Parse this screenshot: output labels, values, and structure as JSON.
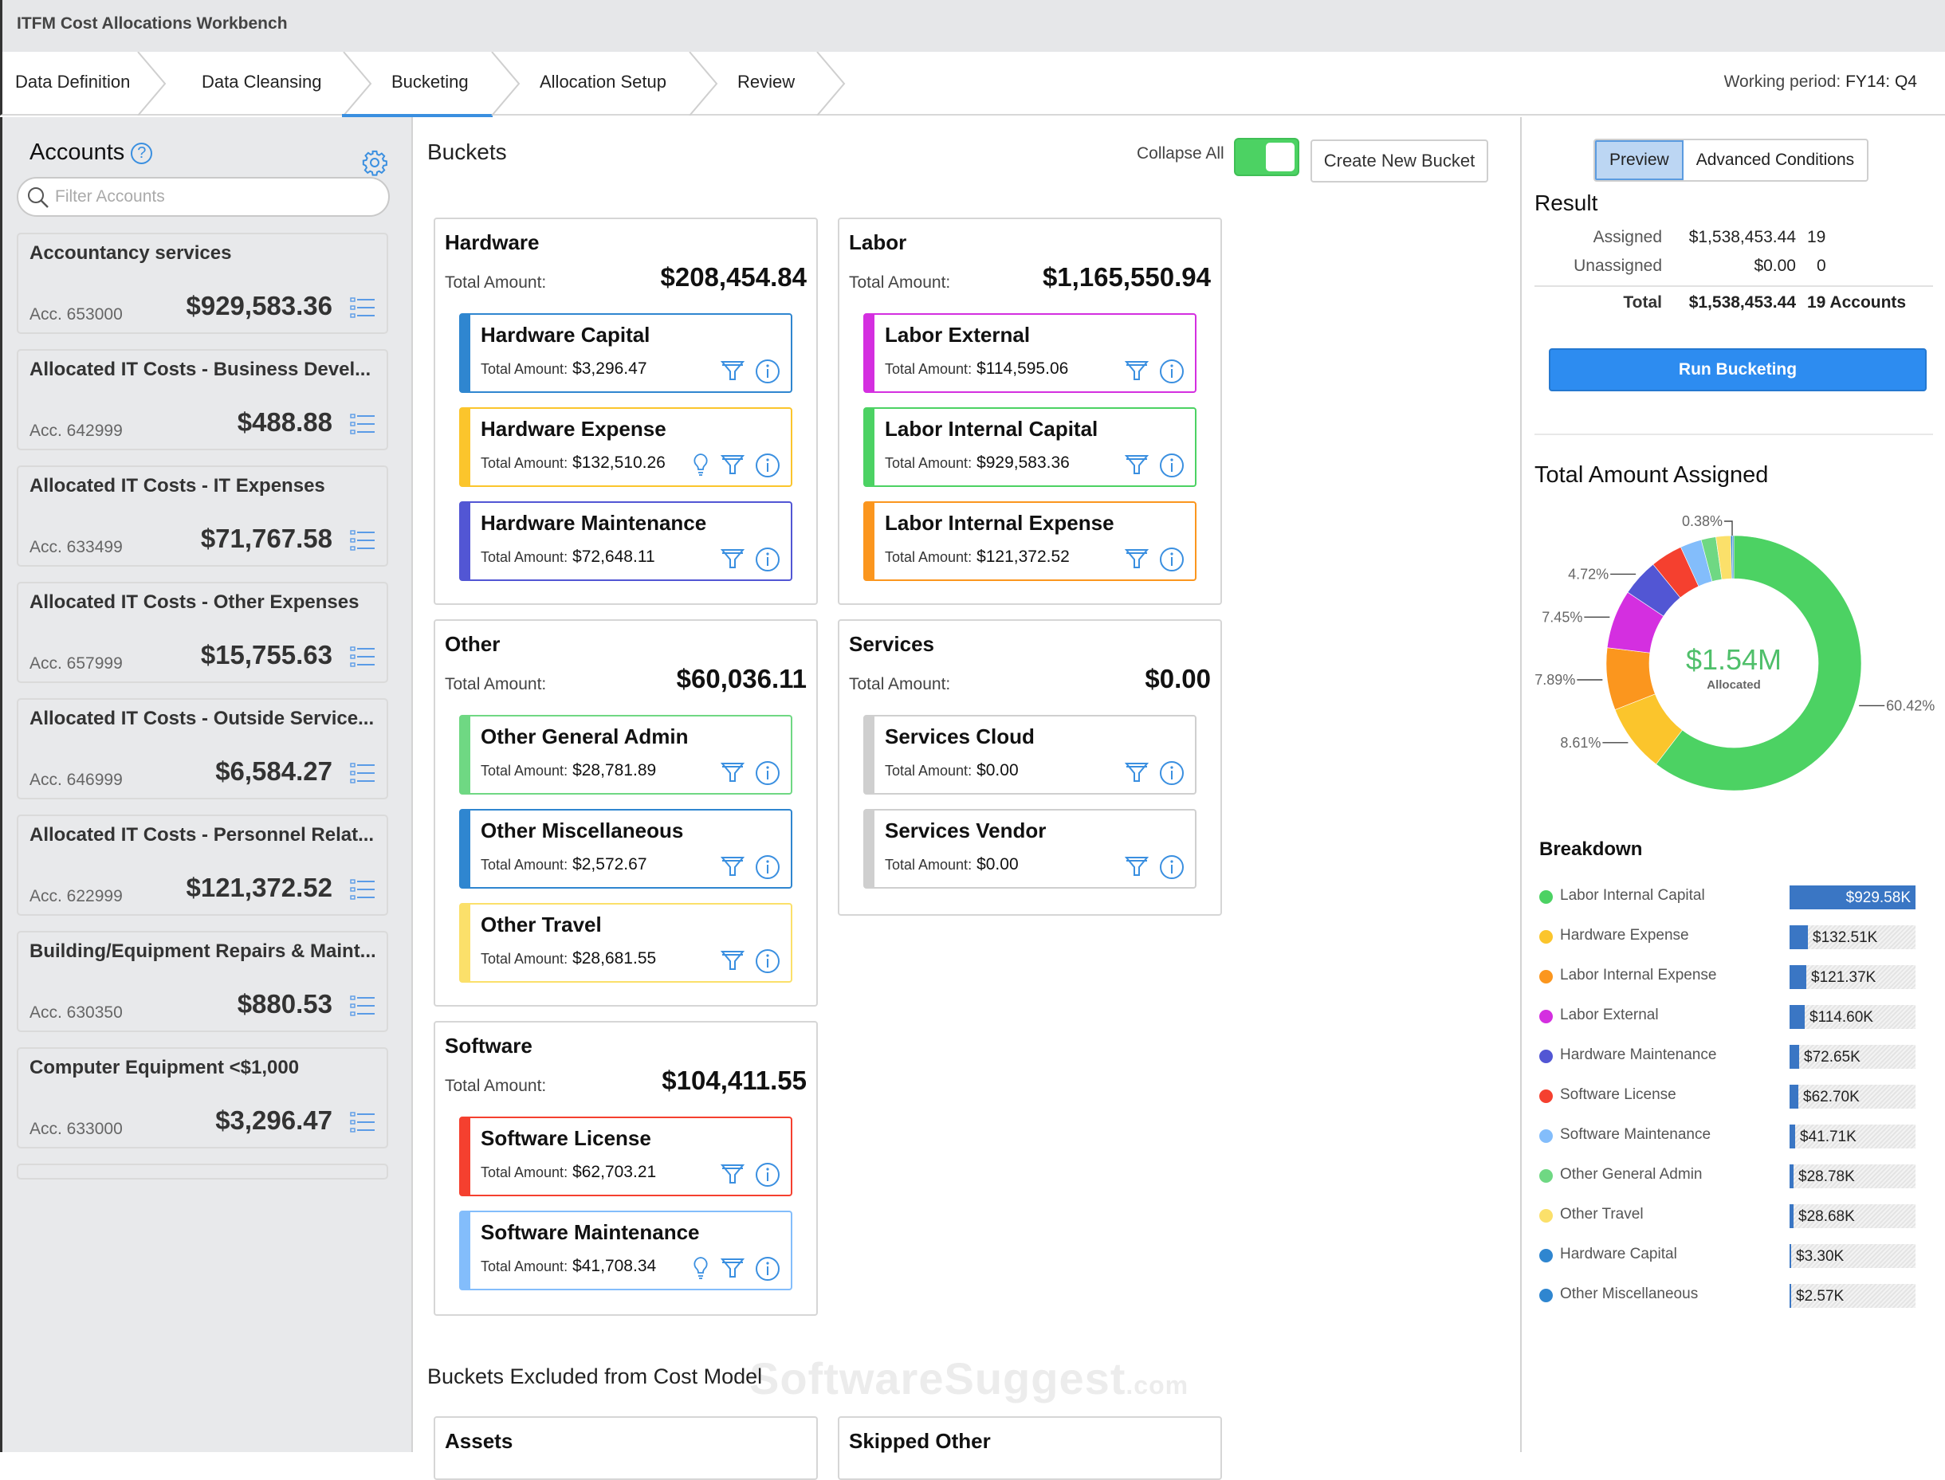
{
  "app": {
    "title": "ITFM Cost Allocations Workbench"
  },
  "tabs": [
    {
      "label": "Data Definition",
      "active": false
    },
    {
      "label": "Data Cleansing",
      "active": false
    },
    {
      "label": "Bucketing",
      "active": true
    },
    {
      "label": "Allocation Setup",
      "active": false
    },
    {
      "label": "Review",
      "active": false
    }
  ],
  "working_period": {
    "label": "Working period:",
    "value": "FY14: Q4"
  },
  "accounts_panel": {
    "title": "Accounts",
    "help_icon": "question-circle-icon",
    "settings_icon": "gear-icon",
    "filter_placeholder": "Filter Accounts",
    "filter_value": "",
    "items": [
      {
        "name": "Accountancy services",
        "number": "Acc. 653000",
        "amount": "$929,583.36"
      },
      {
        "name": "Allocated IT Costs - Business Devel...",
        "number": "Acc. 642999",
        "amount": "$488.88"
      },
      {
        "name": "Allocated IT Costs - IT Expenses",
        "number": "Acc. 633499",
        "amount": "$71,767.58"
      },
      {
        "name": "Allocated IT Costs - Other Expenses",
        "number": "Acc. 657999",
        "amount": "$15,755.63"
      },
      {
        "name": "Allocated IT Costs - Outside Service...",
        "number": "Acc. 646999",
        "amount": "$6,584.27"
      },
      {
        "name": "Allocated IT Costs - Personnel Relat...",
        "number": "Acc. 622999",
        "amount": "$121,372.52"
      },
      {
        "name": "Building/Equipment Repairs & Maint...",
        "number": "Acc. 630350",
        "amount": "$880.53"
      },
      {
        "name": "Computer Equipment <$1,000",
        "number": "Acc. 633000",
        "amount": "$3,296.47"
      }
    ]
  },
  "buckets": {
    "title": "Buckets",
    "collapse_all_label": "Collapse All",
    "collapse_all_on": true,
    "create_button": "Create New Bucket",
    "total_label": "Total Amount:",
    "sub_total_label": "Total Amount:",
    "groups": [
      {
        "name": "Hardware",
        "total": "$208,454.84",
        "items": [
          {
            "name": "Hardware Capital",
            "amount": "$3,296.47",
            "color": "#2f86d0",
            "hint": false
          },
          {
            "name": "Hardware Expense",
            "amount": "$132,510.26",
            "color": "#fbc52c",
            "hint": true
          },
          {
            "name": "Hardware Maintenance",
            "amount": "$72,648.11",
            "color": "#5256d4",
            "hint": false
          }
        ]
      },
      {
        "name": "Labor",
        "total": "$1,165,550.94",
        "items": [
          {
            "name": "Labor External",
            "amount": "$114,595.06",
            "color": "#d42fe0",
            "hint": false
          },
          {
            "name": "Labor Internal Capital",
            "amount": "$929,583.36",
            "color": "#4cd263",
            "hint": false
          },
          {
            "name": "Labor Internal Expense",
            "amount": "$121,372.52",
            "color": "#fb961e",
            "hint": false
          }
        ]
      },
      {
        "name": "Other",
        "total": "$60,036.11",
        "items": [
          {
            "name": "Other General Admin",
            "amount": "$28,781.89",
            "color": "#6fd883",
            "hint": false
          },
          {
            "name": "Other Miscellaneous",
            "amount": "$2,572.67",
            "color": "#2f86d0",
            "hint": false
          },
          {
            "name": "Other Travel",
            "amount": "$28,681.55",
            "color": "#fbe06a",
            "hint": false
          }
        ]
      },
      {
        "name": "Services",
        "total": "$0.00",
        "items": [
          {
            "name": "Services Cloud",
            "amount": "$0.00",
            "color": "#cfcfcf",
            "hint": false
          },
          {
            "name": "Services Vendor",
            "amount": "$0.00",
            "color": "#cfcfcf",
            "hint": false
          }
        ]
      },
      {
        "name": "Software",
        "total": "$104,411.55",
        "items": [
          {
            "name": "Software License",
            "amount": "$62,703.21",
            "color": "#f5402f",
            "hint": false
          },
          {
            "name": "Software Maintenance",
            "amount": "$41,708.34",
            "color": "#83bdfb",
            "hint": true
          }
        ]
      }
    ],
    "excluded_title": "Buckets Excluded from Cost Model",
    "excluded_groups": [
      {
        "name": "Assets"
      },
      {
        "name": "Skipped Other"
      }
    ]
  },
  "watermark": {
    "main": "SoftwareSuggest",
    "suffix": ".com"
  },
  "right_panel": {
    "segments": [
      {
        "label": "Preview",
        "active": true
      },
      {
        "label": "Advanced Conditions",
        "active": false
      }
    ],
    "result_title": "Result",
    "rows": [
      {
        "label": "Assigned",
        "amount": "$1,538,453.44",
        "count": "19"
      },
      {
        "label": "Unassigned",
        "amount": "$0.00",
        "count": "0"
      }
    ],
    "total": {
      "label": "Total",
      "amount": "$1,538,453.44",
      "count": "19 Accounts"
    },
    "run_button": "Run Bucketing",
    "chart_title": "Total Amount Assigned",
    "center_value": "$1.54M",
    "center_label": "Allocated",
    "breakdown_title": "Breakdown",
    "accent": "#2d8cf0"
  },
  "chart_data": {
    "type": "pie",
    "title": "Total Amount Assigned",
    "donut": true,
    "center_text": "$1.54M Allocated",
    "total": 1538453.44,
    "categories": [
      "Labor Internal Capital",
      "Hardware Expense",
      "Labor Internal Expense",
      "Labor External",
      "Hardware Maintenance",
      "Software License",
      "Software Maintenance",
      "Other General Admin",
      "Other Travel",
      "Hardware Capital",
      "Other Miscellaneous"
    ],
    "values": [
      929583.36,
      132510.26,
      121372.52,
      114595.06,
      72648.11,
      62703.21,
      41708.34,
      28781.89,
      28681.55,
      3296.47,
      2572.67
    ],
    "colors": [
      "#4cd263",
      "#fbc52c",
      "#fb961e",
      "#d42fe0",
      "#5256d4",
      "#f5402f",
      "#83bdfb",
      "#6fd883",
      "#fbe06a",
      "#2f86d0",
      "#2f86d0"
    ],
    "slice_labels": [
      {
        "category": "Labor Internal Capital",
        "text": "60.42%"
      },
      {
        "category": "Hardware Expense",
        "text": "8.61%"
      },
      {
        "category": "Labor Internal Expense",
        "text": "7.89%"
      },
      {
        "category": "Labor External",
        "text": "7.45%"
      },
      {
        "category": "Hardware Maintenance",
        "text": "4.72%"
      },
      {
        "category": "Other Miscellaneous",
        "text": "0.38%"
      }
    ],
    "breakdown": [
      {
        "label": "Labor Internal Capital",
        "value": "$929.58K",
        "color": "#4cd263"
      },
      {
        "label": "Hardware Expense",
        "value": "$132.51K",
        "color": "#fbc52c"
      },
      {
        "label": "Labor Internal Expense",
        "value": "$121.37K",
        "color": "#fb961e"
      },
      {
        "label": "Labor External",
        "value": "$114.60K",
        "color": "#d42fe0"
      },
      {
        "label": "Hardware Maintenance",
        "value": "$72.65K",
        "color": "#5256d4"
      },
      {
        "label": "Software License",
        "value": "$62.70K",
        "color": "#f5402f"
      },
      {
        "label": "Software Maintenance",
        "value": "$41.71K",
        "color": "#83bdfb"
      },
      {
        "label": "Other General Admin",
        "value": "$28.78K",
        "color": "#6fd883"
      },
      {
        "label": "Other Travel",
        "value": "$28.68K",
        "color": "#fbe06a"
      },
      {
        "label": "Hardware Capital",
        "value": "$3.30K",
        "color": "#2f86d0"
      },
      {
        "label": "Other Miscellaneous",
        "value": "$2.57K",
        "color": "#2f86d0"
      }
    ]
  }
}
